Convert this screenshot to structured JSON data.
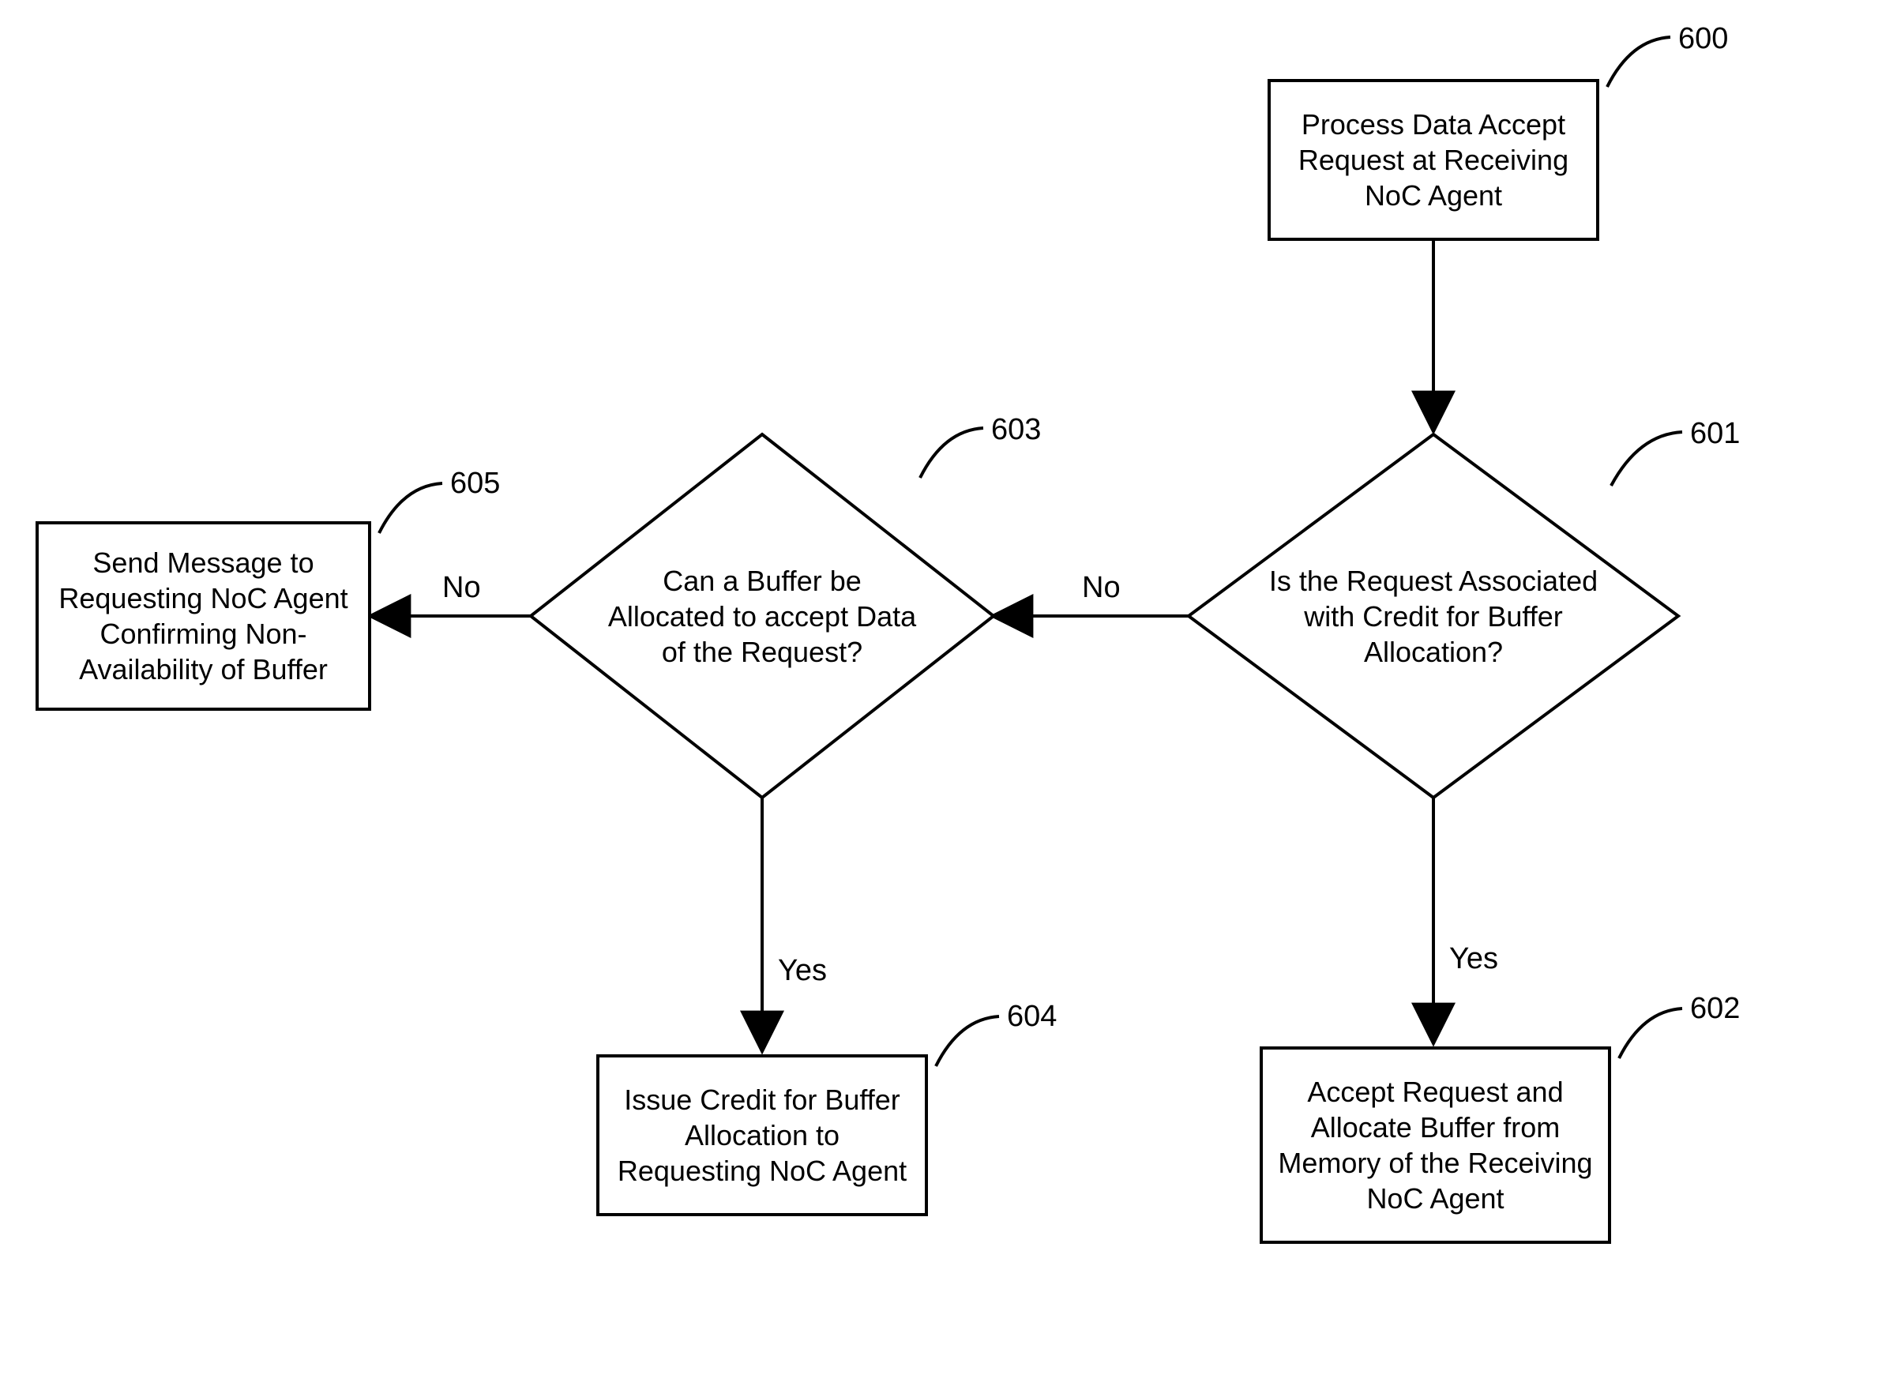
{
  "boxes": {
    "b600": "Process Data Accept Request at Receiving NoC Agent",
    "b601": "Is the Request Associated with Credit for Buffer Allocation?",
    "b602": "Accept Request and Allocate Buffer from Memory of the Receiving NoC Agent",
    "b603": "Can a Buffer be Allocated to accept Data of the Request?",
    "b604": "Issue Credit for Buffer Allocation to Requesting NoC Agent",
    "b605": "Send Message to Requesting NoC Agent Confirming Non-Availability of Buffer"
  },
  "refs": {
    "r600": "600",
    "r601": "601",
    "r602": "602",
    "r603": "603",
    "r604": "604",
    "r605": "605"
  },
  "labels": {
    "no_601": "No",
    "yes_601": "Yes",
    "no_603": "No",
    "yes_603": "Yes"
  }
}
